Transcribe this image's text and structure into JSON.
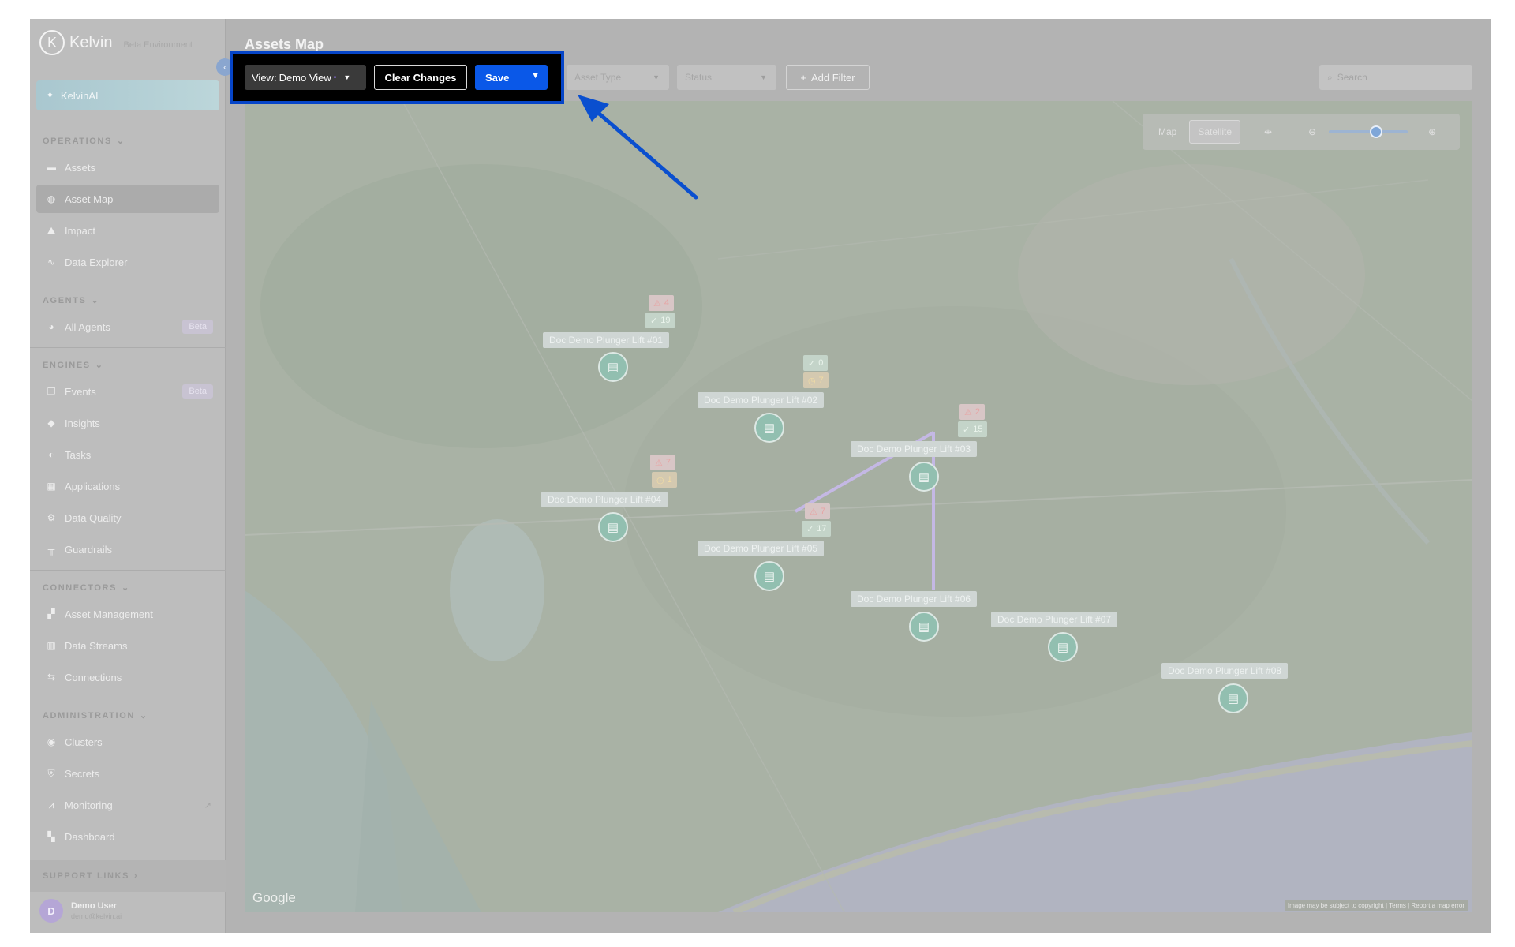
{
  "app": {
    "name": "Kelvin",
    "subtitle": "Beta Environment"
  },
  "sidebar": {
    "kelvin_ai": "KelvinAI",
    "sections": {
      "operations": "OPERATIONS",
      "agents": "AGENTS",
      "engines": "ENGINES",
      "connectors": "CONNECTORS",
      "administration": "ADMINISTRATION",
      "support": "SUPPORT LINKS"
    },
    "items": {
      "assets": "Assets",
      "asset_map": "Asset Map",
      "impact": "Impact",
      "data_explorer": "Data Explorer",
      "all_agents": "All Agents",
      "events": "Events",
      "insights": "Insights",
      "tasks": "Tasks",
      "applications": "Applications",
      "data_quality": "Data Quality",
      "guardrails": "Guardrails",
      "asset_management": "Asset Management",
      "data_streams": "Data Streams",
      "connections": "Connections",
      "clusters": "Clusters",
      "secrets": "Secrets",
      "monitoring": "Monitoring",
      "dashboard": "Dashboard"
    },
    "beta_label": "Beta",
    "user": {
      "initial": "D",
      "name": "Demo User",
      "email": "demo@kelvin.ai"
    }
  },
  "header": {
    "title": "Assets Map"
  },
  "toolbar": {
    "view_prefix": "View:",
    "view_name": "Demo View",
    "clear_label": "Clear Changes",
    "save_label": "Save",
    "asset_type_label": "Asset Type",
    "status_label": "Status",
    "add_filter_label": "Add Filter",
    "search_placeholder": "Search"
  },
  "map": {
    "map_label": "Map",
    "satellite_label": "Satellite",
    "zoom_level": 0.6,
    "google": "Google",
    "attribution": "Image may be subject to copyright  |  Terms  |  Report a map error",
    "assets": [
      {
        "name": "Doc Demo Plunger Lift #01",
        "red": "4",
        "second": "19",
        "second_type": "green"
      },
      {
        "name": "Doc Demo Plunger Lift #02",
        "red": "0",
        "second": "7",
        "second_type": "orange",
        "first_type": "green"
      },
      {
        "name": "Doc Demo Plunger Lift #03",
        "red": "2",
        "second": "15",
        "second_type": "green"
      },
      {
        "name": "Doc Demo Plunger Lift #04",
        "red": "7",
        "second": "1",
        "second_type": "orange"
      },
      {
        "name": "Doc Demo Plunger Lift #05",
        "red": "7",
        "second": "17",
        "second_type": "green"
      },
      {
        "name": "Doc Demo Plunger Lift #06"
      },
      {
        "name": "Doc Demo Plunger Lift #07"
      },
      {
        "name": "Doc Demo Plunger Lift #08"
      }
    ]
  },
  "colors": {
    "highlight_border": "#0645c8",
    "save_button": "#0a58e8",
    "arrow": "#0a4fcf"
  }
}
